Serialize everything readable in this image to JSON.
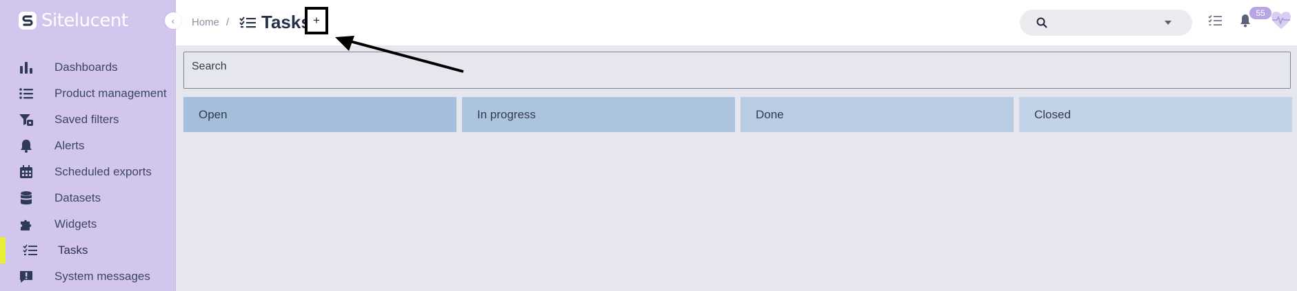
{
  "brand": {
    "name": "Sitelucent"
  },
  "sidebar": {
    "collapse_icon": "chevron-left-icon",
    "items": [
      {
        "label": "Dashboards",
        "icon": "bar-chart-icon",
        "active": false
      },
      {
        "label": "Product management",
        "icon": "list-icon",
        "active": false
      },
      {
        "label": "Saved filters",
        "icon": "saved-filter-icon",
        "active": false
      },
      {
        "label": "Alerts",
        "icon": "bell-icon",
        "active": false
      },
      {
        "label": "Scheduled exports",
        "icon": "calendar-icon",
        "active": false
      },
      {
        "label": "Datasets",
        "icon": "database-icon",
        "active": false
      },
      {
        "label": "Widgets",
        "icon": "puzzle-icon",
        "active": false
      },
      {
        "label": "Tasks",
        "icon": "checklist-icon",
        "active": true
      },
      {
        "label": "System messages",
        "icon": "message-alert-icon",
        "active": false
      }
    ]
  },
  "header": {
    "breadcrumb_home": "Home",
    "breadcrumb_separator": "/",
    "title": "Tasks",
    "add_label": "+",
    "search_value": "",
    "notifications_count": "55"
  },
  "main": {
    "search_label": "Search",
    "columns": [
      {
        "label": "Open"
      },
      {
        "label": "In progress"
      },
      {
        "label": "Done"
      },
      {
        "label": "Closed"
      }
    ]
  },
  "colors": {
    "sidebar_bg": "#d2c6ee",
    "active_accent": "#e6ef34",
    "column_open": "#a4bedb",
    "column_in_progress": "#adc4df",
    "column_done": "#b9cce3",
    "column_closed": "#c2d3e8",
    "badge": "#b7a6e3"
  }
}
